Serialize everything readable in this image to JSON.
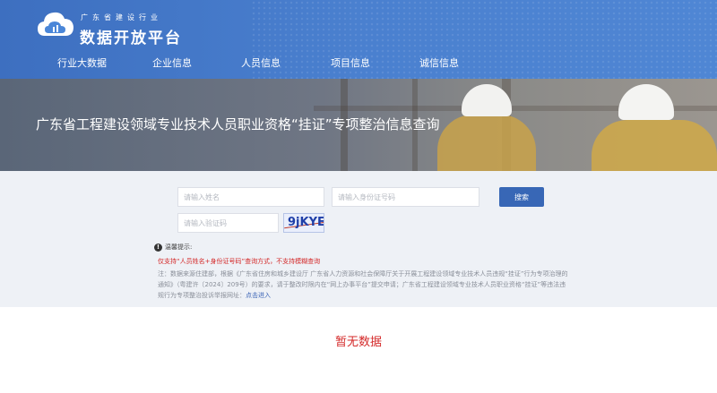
{
  "brand": {
    "subtitle": "广东省建设行业",
    "title": "数据开放平台"
  },
  "nav": {
    "items": [
      {
        "label": "行业大数据"
      },
      {
        "label": "企业信息"
      },
      {
        "label": "人员信息"
      },
      {
        "label": "项目信息"
      },
      {
        "label": "诚信信息"
      }
    ]
  },
  "banner": {
    "title": "广东省工程建设领域专业技术人员职业资格“挂证”专项整治信息查询"
  },
  "search": {
    "name_placeholder": "请输入姓名",
    "id_placeholder": "请输入身份证号码",
    "captcha_placeholder": "请输入验证码",
    "captcha_text": "9jKYE",
    "button_label": "搜索"
  },
  "tips": {
    "title": "温馨提示:",
    "highlight": "仅支持“人员姓名+身份证号码”查询方式，不支持模糊查询",
    "note_part1": "注：数据来源住建部，根据《广东省住房和城乡建设厅 广东省人力资源和社会保障厅关于开展工程建设领域专业技术人员违规“挂证”行为专项治理的通知》（粤建许〔2024〕209号）的要求，请于整改时限内在“网上办事平台”提交申请；广东省工程建设领域专业技术人员职业资格“挂证”等违法违规行为专项整治投诉举报网址：",
    "note_link": "点击进入"
  },
  "results": {
    "empty_text": "暂无数据"
  },
  "colors": {
    "header_blue": "#4a80cf",
    "button_blue": "#3867b6",
    "alert_red": "#d42a2a"
  },
  "icons": {
    "logo": "cloud-logo-icon",
    "tip": "info-icon"
  }
}
